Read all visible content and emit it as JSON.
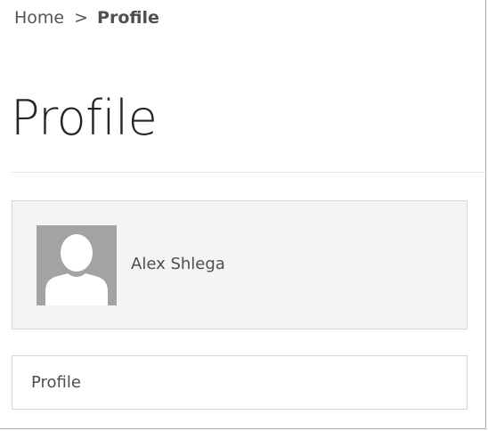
{
  "breadcrumb": {
    "home": "Home",
    "separator": ">",
    "current": "Profile"
  },
  "page": {
    "title": "Profile"
  },
  "profile_card": {
    "avatar_icon": "default-user-avatar-icon",
    "name": "Alex Shlega"
  },
  "profile_section": {
    "label": "Profile"
  },
  "colors": {
    "card_background": "#f4f4f4",
    "card_border": "#d6d6d6",
    "avatar_background": "#a3a3a3",
    "text": "#4e4e4e",
    "title_text": "#262626"
  }
}
